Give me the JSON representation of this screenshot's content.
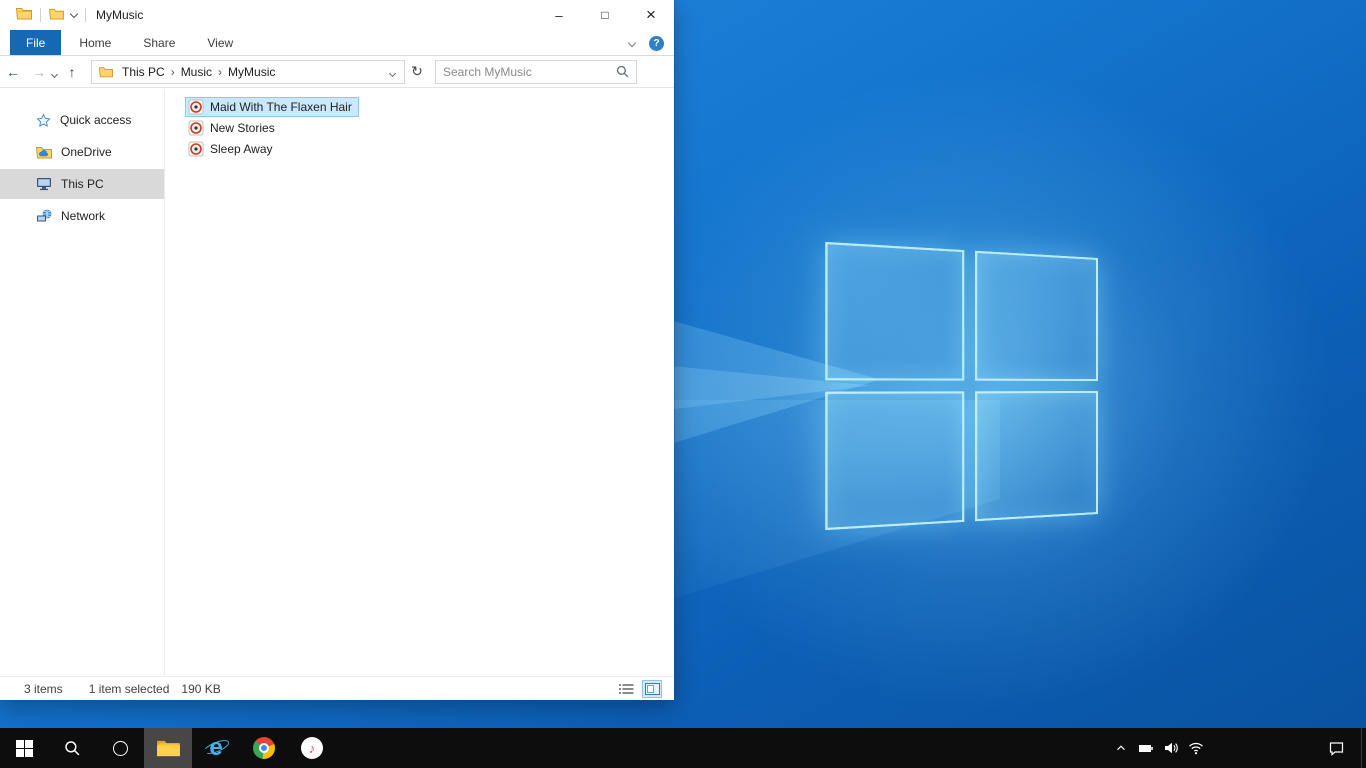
{
  "icons": {
    "breadcrumb_chevron": "›",
    "back": "←",
    "forward": "→",
    "up": "↑",
    "refresh": "↻",
    "minimize": "–",
    "maximize": "□",
    "close": "×",
    "help": "?",
    "ie_glyph": "e",
    "itunes_glyph": "♪"
  },
  "explorer": {
    "title": "MyMusic",
    "tabs": {
      "file": "File",
      "home": "Home",
      "share": "Share",
      "view": "View"
    },
    "breadcrumb": {
      "segments": [
        "This PC",
        "Music",
        "MyMusic"
      ]
    },
    "search": {
      "placeholder": "Search MyMusic"
    },
    "sidebar": {
      "items": [
        {
          "label": "Quick access"
        },
        {
          "label": "OneDrive"
        },
        {
          "label": "This PC"
        },
        {
          "label": "Network"
        }
      ]
    },
    "files": [
      {
        "name": "Maid With The Flaxen Hair"
      },
      {
        "name": "New Stories"
      },
      {
        "name": "Sleep Away"
      }
    ],
    "status": {
      "count": "3 items",
      "selection": "1 item selected",
      "size": "190 KB"
    }
  },
  "colors": {
    "accent": "#1668b4",
    "selection_fill": "#cce8ff",
    "selection_border": "#90c8f0",
    "sidebar_selected": "#d9d9d9",
    "taskbar": "#0d0d0d",
    "wallpaper_base": "#0c5fb6",
    "wallpaper_glow": "#87daff"
  }
}
